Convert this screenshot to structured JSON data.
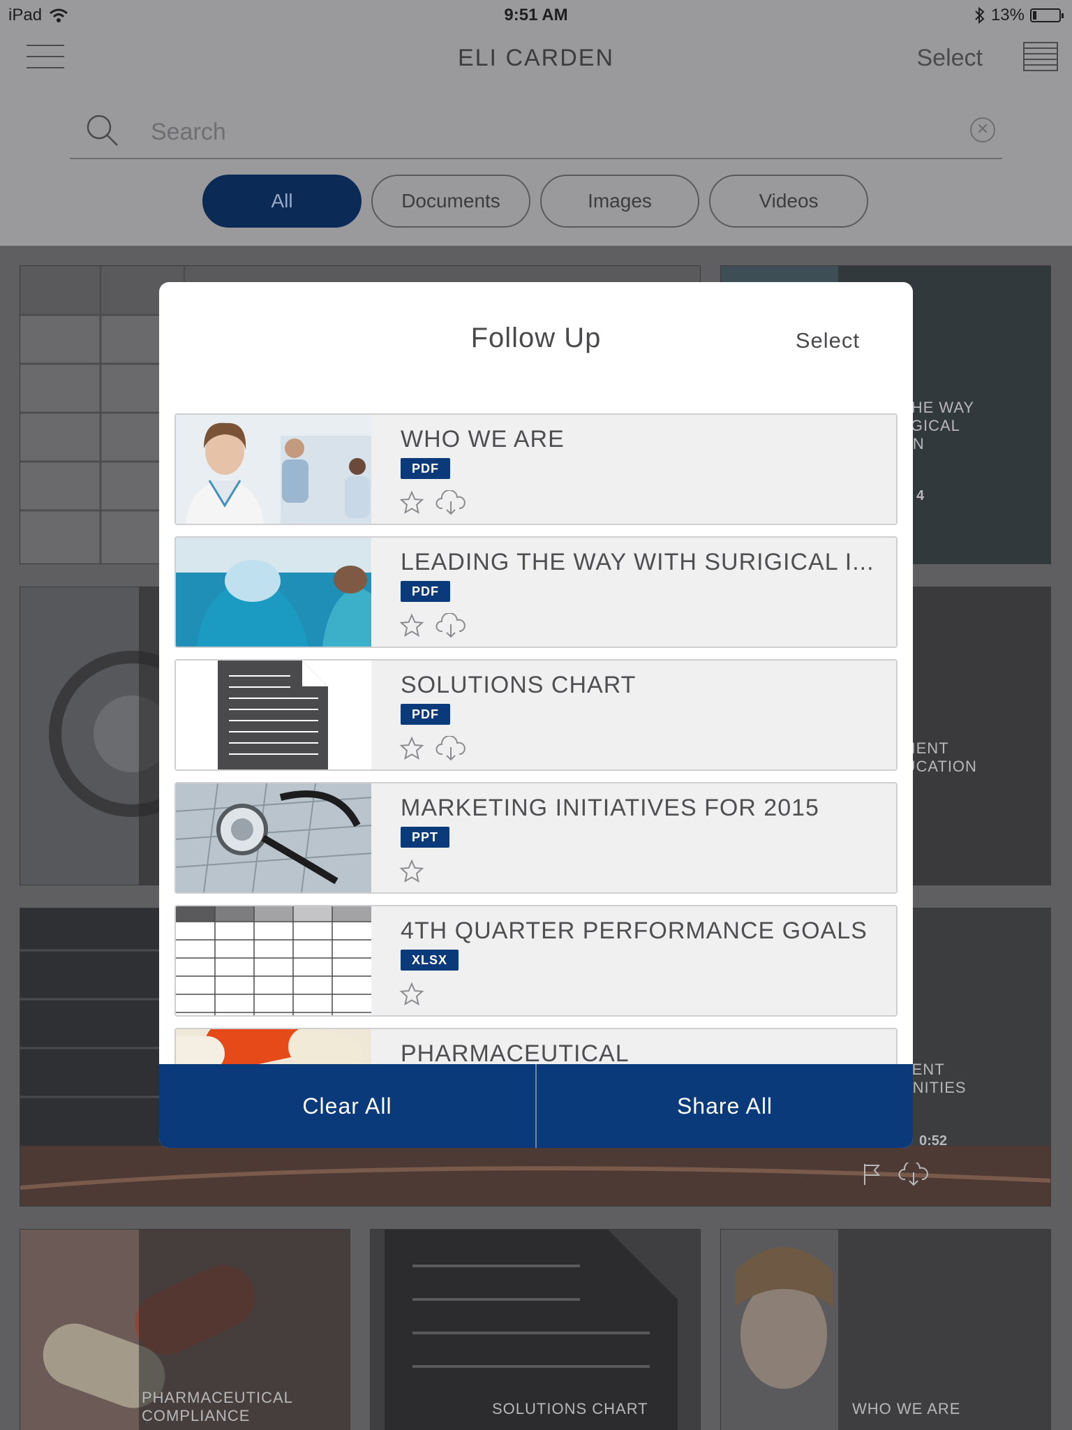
{
  "status_bar": {
    "device": "iPad",
    "time": "9:51 AM",
    "battery_percent": "13%",
    "battery_level": 0.13
  },
  "header": {
    "title": "ELI CARDEN",
    "select_label": "Select"
  },
  "search": {
    "placeholder": "Search"
  },
  "filters": [
    {
      "label": "All",
      "active": true
    },
    {
      "label": "Documents",
      "active": false
    },
    {
      "label": "Images",
      "active": false
    },
    {
      "label": "Videos",
      "active": false
    }
  ],
  "background_tiles": {
    "tile_leading_label": "LEADING THE WAY\nWITH SURIGICAL\nINNOVATION",
    "tile_leading_meta": "4",
    "tile_patient_ed_label": "PATIENT\nEDUCATION",
    "tile_patient_amen_label": "PATIENT\nAMENITIES",
    "tile_patient_amen_duration": "0:52",
    "tile_pharma_label": "PHARMACEUTICAL\nCOMPLIANCE",
    "tile_solutions_label": "SOLUTIONS CHART",
    "tile_who_label": "WHO WE ARE"
  },
  "modal": {
    "title": "Follow Up",
    "select_label": "Select",
    "items": [
      {
        "title": "WHO WE ARE",
        "type": "PDF",
        "thumb": "doctor-photo",
        "downloadable": true
      },
      {
        "title": "LEADING THE WAY WITH SURIGICAL I...",
        "type": "PDF",
        "thumb": "surgery-photo",
        "downloadable": true
      },
      {
        "title": "SOLUTIONS CHART",
        "type": "PDF",
        "thumb": "document-icon",
        "downloadable": true
      },
      {
        "title": "MARKETING INITIATIVES FOR 2015",
        "type": "PPT",
        "thumb": "stethoscope-photo",
        "downloadable": false
      },
      {
        "title": "4TH QUARTER PERFORMANCE GOALS",
        "type": "XLSX",
        "thumb": "spreadsheet-icon",
        "downloadable": false
      },
      {
        "title": "PHARMACEUTICAL",
        "type": "",
        "thumb": "pills-photo",
        "downloadable": false
      }
    ],
    "clear_all_label": "Clear All",
    "share_all_label": "Share All"
  },
  "colors": {
    "brand_navy": "#0b3a7a",
    "overlay_gray": "#9a9a9d",
    "row_bg": "#f0f0f0"
  }
}
